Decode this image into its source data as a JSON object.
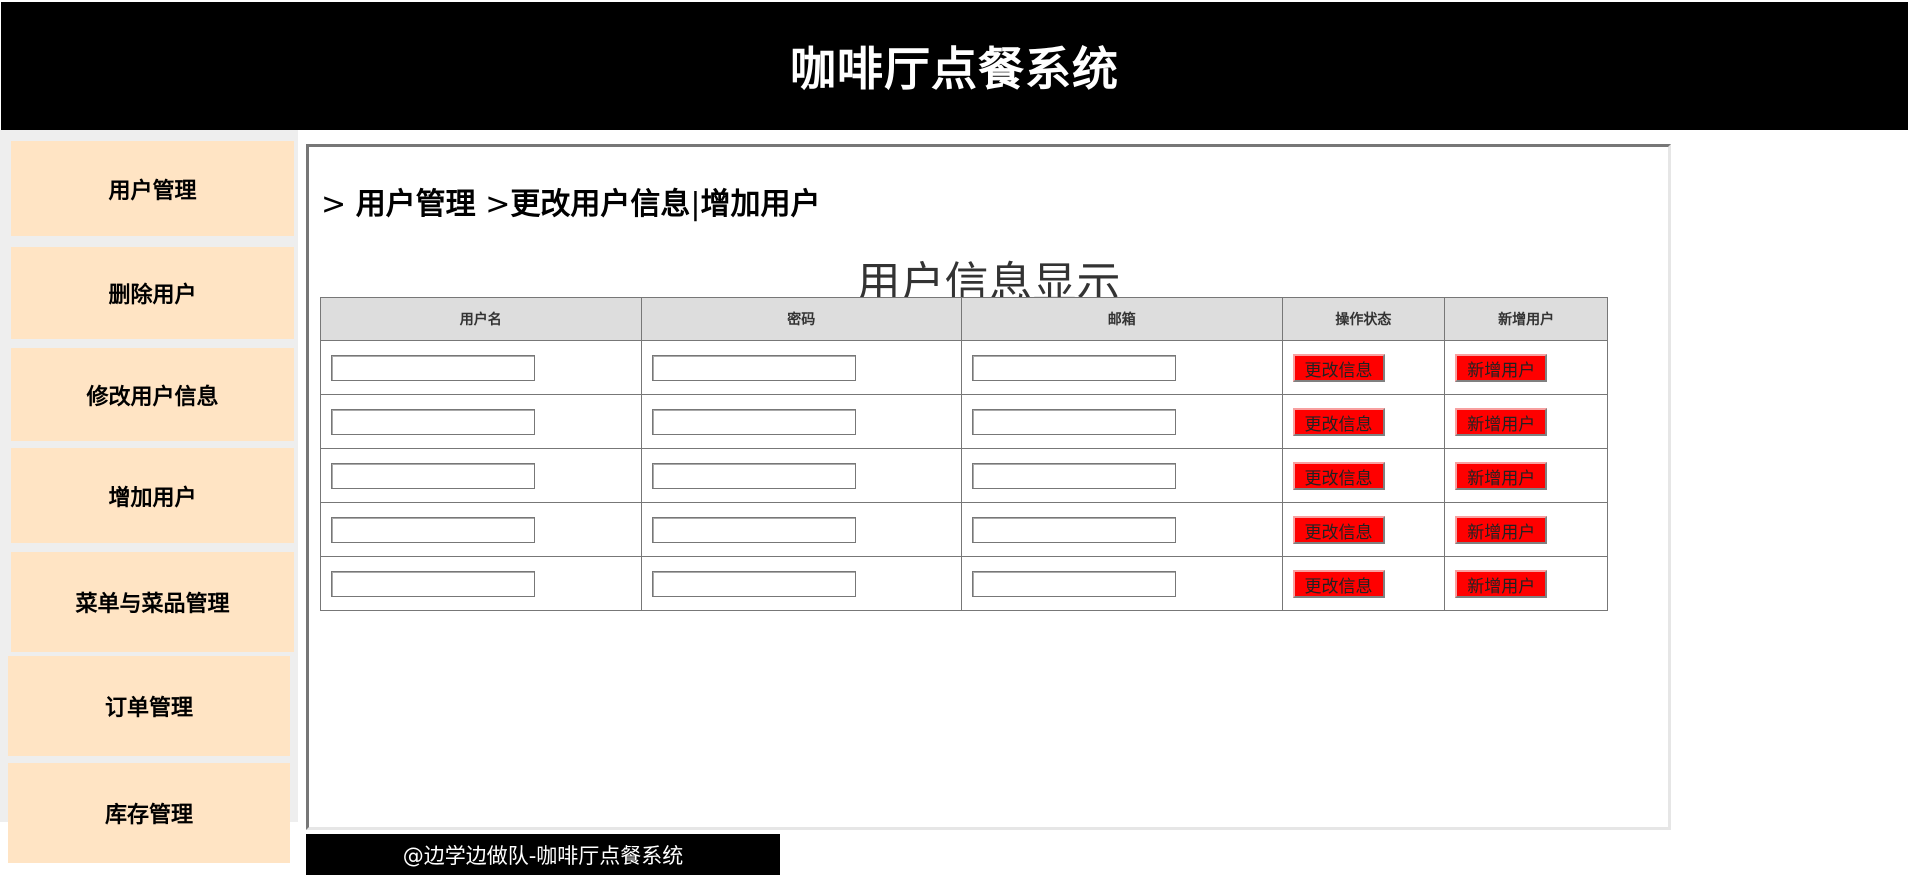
{
  "header": {
    "title": "咖啡厅点餐系统"
  },
  "sidebar": {
    "items": [
      {
        "label": "用户管理"
      },
      {
        "label": "删除用户"
      },
      {
        "label": "修改用户信息"
      },
      {
        "label": "增加用户"
      },
      {
        "label": "菜单与菜品管理"
      },
      {
        "label": "订单管理"
      },
      {
        "label": "库存管理"
      }
    ]
  },
  "breadcrumb": {
    "sep1": "> ",
    "section": "用户管理",
    "sep2": " >",
    "page1": "更改用户信息",
    "divider": "|",
    "page2": "增加用户"
  },
  "table": {
    "title": "用户信息显示",
    "headers": [
      "用户名",
      "密码",
      "邮箱",
      "操作状态",
      "新增用户"
    ],
    "rows": [
      {
        "username": "",
        "password": "",
        "email": "",
        "edit_label": "更改信息",
        "add_label": "新增用户"
      },
      {
        "username": "",
        "password": "",
        "email": "",
        "edit_label": "更改信息",
        "add_label": "新增用户"
      },
      {
        "username": "",
        "password": "",
        "email": "",
        "edit_label": "更改信息",
        "add_label": "新增用户"
      },
      {
        "username": "",
        "password": "",
        "email": "",
        "edit_label": "更改信息",
        "add_label": "新增用户"
      },
      {
        "username": "",
        "password": "",
        "email": "",
        "edit_label": "更改信息",
        "add_label": "新增用户"
      }
    ]
  },
  "footer": {
    "text": "@边学边做队-咖啡厅点餐系统"
  },
  "colors": {
    "header_bg": "#000000",
    "sidebar_item_bg": "#ffe4c4",
    "button_bg": "#ff0000",
    "table_header_bg": "#dddddd"
  }
}
